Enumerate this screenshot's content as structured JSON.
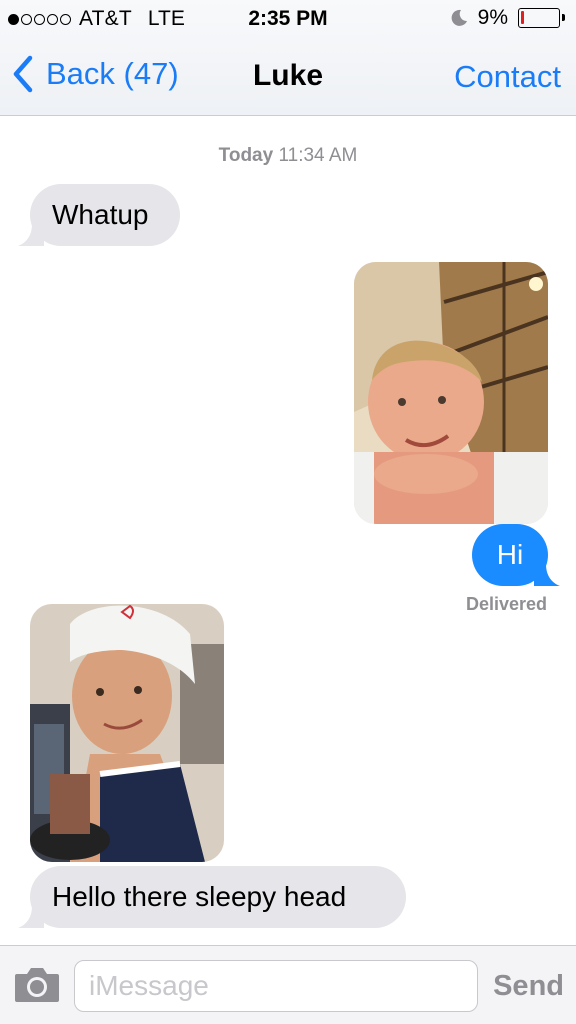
{
  "status_bar": {
    "signal_filled": 1,
    "signal_total": 5,
    "carrier": "AT&T",
    "network": "LTE",
    "time": "2:35 PM",
    "battery_percent": "9%",
    "battery_level": 0.09
  },
  "nav": {
    "back_label": "Back (47)",
    "title": "Luke",
    "contact_label": "Contact"
  },
  "conversation": {
    "timestamp_day": "Today",
    "timestamp_time": "11:34 AM",
    "messages": [
      {
        "direction": "incoming",
        "type": "text",
        "text": "Whatup"
      },
      {
        "direction": "outgoing",
        "type": "photo",
        "description": "selfie"
      },
      {
        "direction": "outgoing",
        "type": "text",
        "text": "Hi"
      },
      {
        "direction": "incoming",
        "type": "photo",
        "description": "selfie"
      },
      {
        "direction": "incoming",
        "type": "text",
        "text": "Hello there sleepy head"
      }
    ],
    "delivered_label": "Delivered"
  },
  "input_bar": {
    "placeholder": "iMessage",
    "send_label": "Send"
  },
  "colors": {
    "accent": "#1a7cf6",
    "outgoing_bubble": "#1a8cff",
    "incoming_bubble": "#e5e5ea",
    "battery_low": "#e02020"
  },
  "icons": [
    "moon-icon",
    "battery-icon",
    "back-chevron-icon",
    "camera-icon"
  ]
}
